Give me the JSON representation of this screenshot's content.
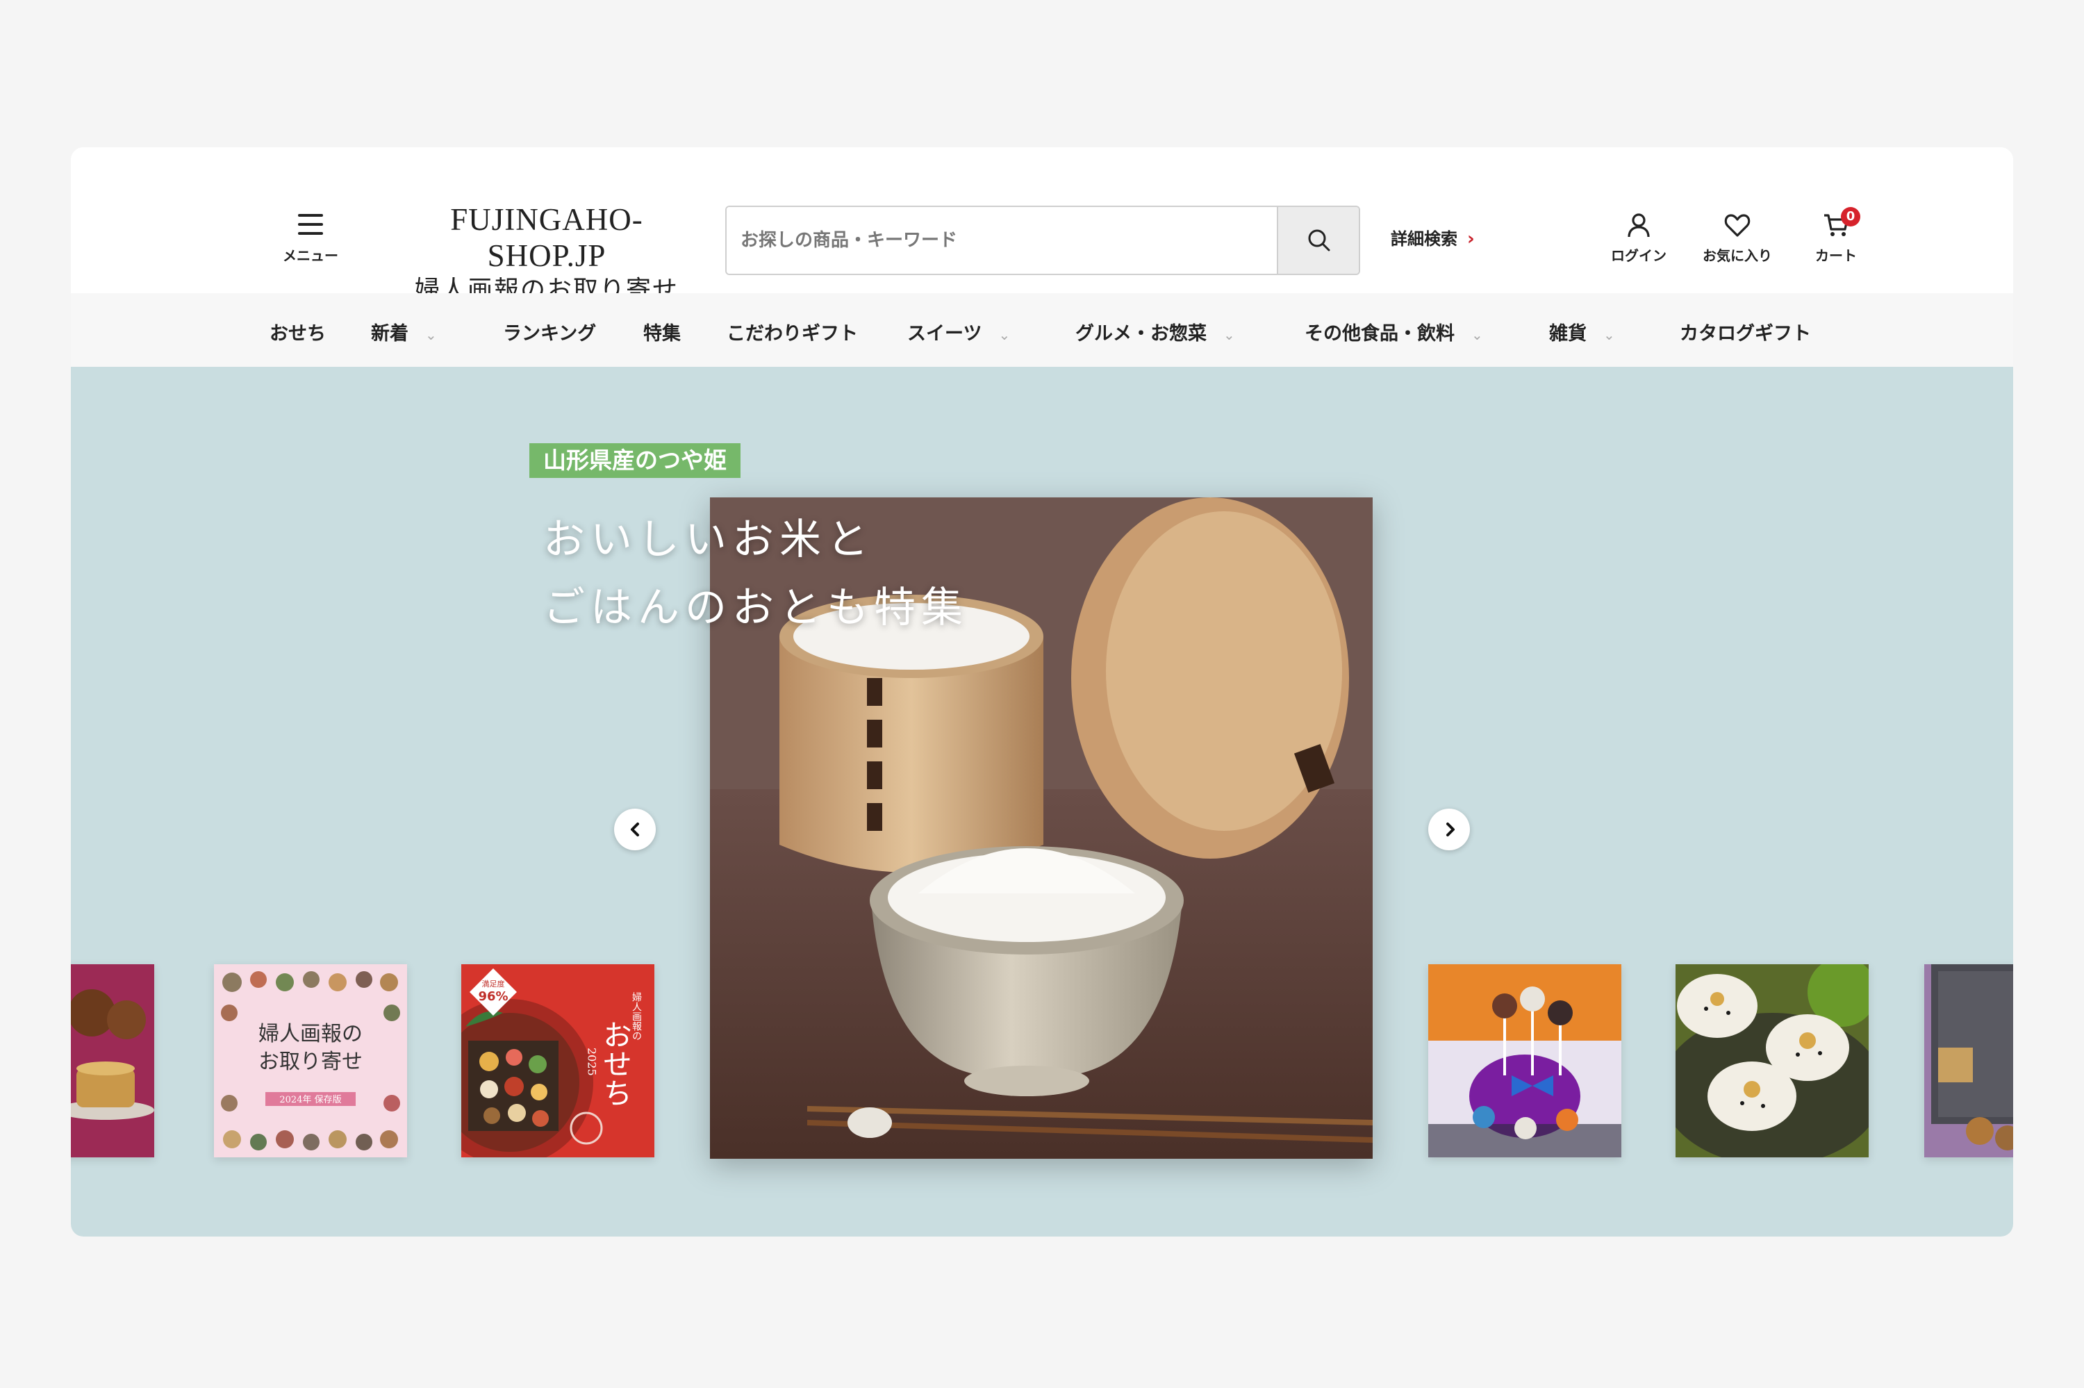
{
  "header": {
    "menu_label": "メニュー",
    "logo_en": "FUJINGAHO-SHOP.JP",
    "logo_ja": "婦人画報のお取り寄せ",
    "search_placeholder": "お探しの商品・キーワード",
    "advanced_search": "詳細検索",
    "login_label": "ログイン",
    "favorites_label": "お気に入り",
    "cart_label": "カート",
    "cart_count": "0",
    "accent_color": "#d6222b"
  },
  "nav": {
    "items": [
      {
        "label": "おせち",
        "dropdown": false
      },
      {
        "label": "新着",
        "dropdown": true
      },
      {
        "label": "ランキング",
        "dropdown": false
      },
      {
        "label": "特集",
        "dropdown": false
      },
      {
        "label": "こだわりギフト",
        "dropdown": false
      },
      {
        "label": "スイーツ",
        "dropdown": true
      },
      {
        "label": "グルメ・お惣菜",
        "dropdown": true
      },
      {
        "label": "その他食品・飲料",
        "dropdown": true
      },
      {
        "label": "雑貨",
        "dropdown": true
      },
      {
        "label": "カタログギフト",
        "dropdown": false
      }
    ]
  },
  "hero": {
    "background": "#c9dde0",
    "tag": "山形県産のつや姫",
    "tag_color": "#76b86a",
    "headline_line1": "おいしいお米と",
    "headline_line2": "ごはんのおとも特集",
    "catalog_card": {
      "title_line1": "婦人画報の",
      "title_line2": "お取り寄せ",
      "subtitle": "2024年 保存版"
    },
    "osechi_card": {
      "badge_top": "満足度",
      "badge_value": "96%",
      "small": "婦人画報の",
      "big": "おせち",
      "year": "2025"
    }
  }
}
